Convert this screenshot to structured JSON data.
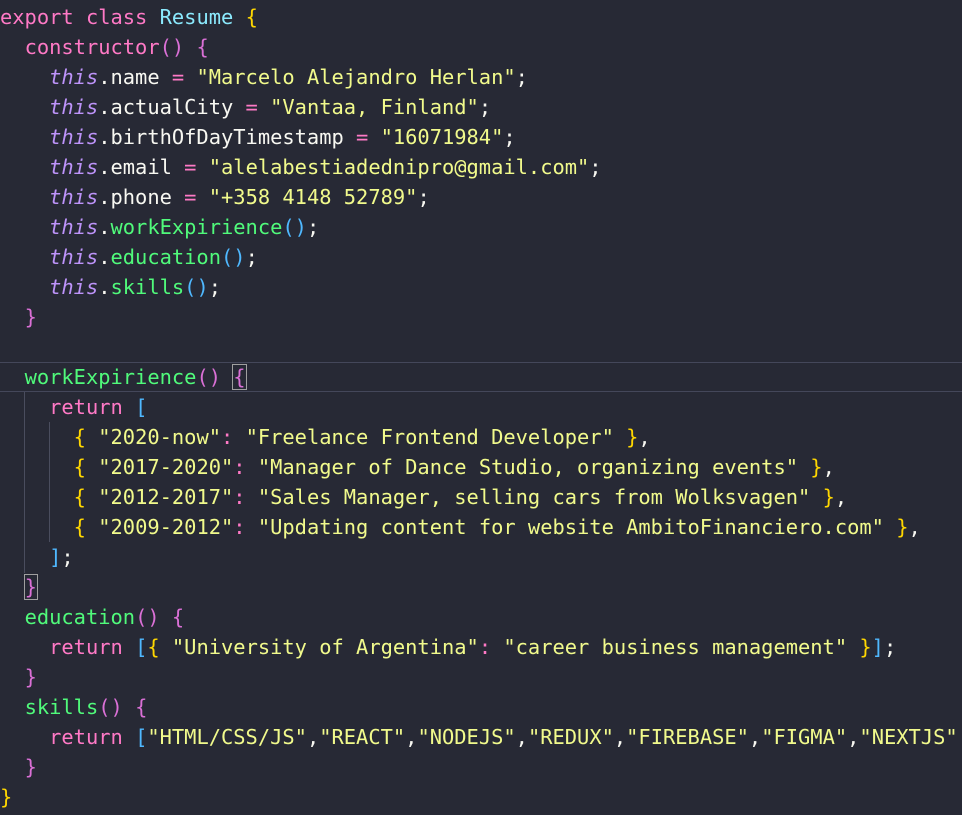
{
  "editor": {
    "kw_export": "export",
    "kw_class": "class",
    "kw_constructor": "constructor",
    "kw_return": "return",
    "kw_this": "this",
    "class_name": "Resume",
    "properties": {
      "name": {
        "key": "name",
        "value": "\"Marcelo Alejandro Herlan\""
      },
      "city": {
        "key": "actualCity",
        "value": "\"Vantaa, Finland\""
      },
      "birth": {
        "key": "birthOfDayTimestamp",
        "value": "\"16071984\""
      },
      "email": {
        "key": "email",
        "value": "\"alelabestiadednipro@gmail.com\""
      },
      "phone": {
        "key": "phone",
        "value": "\"+358 4148 52789\""
      }
    },
    "calls": [
      "workExpirience",
      "education",
      "skills"
    ],
    "methods": {
      "work": "workExpirience",
      "education": "education",
      "skills": "skills"
    },
    "work_experience": [
      {
        "period": "\"2020-now\"",
        "role": "\"Freelance Frontend Developer\""
      },
      {
        "period": "\"2017-2020\"",
        "role": "\"Manager of Dance Studio, organizing events\""
      },
      {
        "period": "\"2012-2017\"",
        "role": "\"Sales Manager, selling cars from Wolksvagen\""
      },
      {
        "period": "\"2009-2012\"",
        "role": "\"Updating content for website AmbitoFinanciero.com\""
      }
    ],
    "education": {
      "school": "\"University of Argentina\"",
      "career": "\"career business management\""
    },
    "skills": [
      "\"HTML/CSS/JS\"",
      "\"REACT\"",
      "\"NODEJS\"",
      "\"REDUX\"",
      "\"FIREBASE\"",
      "\"FIGMA\"",
      "\"NEXTJS\""
    ]
  },
  "colors": {
    "background": "#272935",
    "keyword": "#ff79c6",
    "class_name": "#8be9fd",
    "this": "#bd93f9",
    "function": "#50fa7b",
    "string": "#f1fa8c",
    "bracket_gold": "#ffd700",
    "bracket_orchid": "#da70d6",
    "bracket_blue": "#4fb8ff"
  }
}
